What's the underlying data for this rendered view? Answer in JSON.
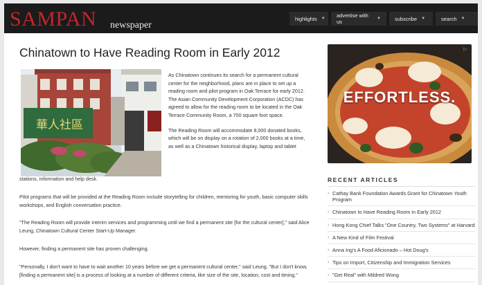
{
  "header": {
    "logo": "SAMPAN",
    "logo_sub": "newspaper",
    "nav": [
      {
        "label": "highlights"
      },
      {
        "label": "advertise with us"
      },
      {
        "label": "subscribe"
      },
      {
        "label": "search"
      }
    ]
  },
  "article": {
    "title": "Chinatown to Have Reading Room in Early 2012",
    "photo_sign": "華人社區",
    "paragraphs": [
      "As Chinatown continues its search for a permanent cultural center for the neighborhood, plans are in place to set up a reading room and pilot program in Oak Terrace for early 2012. The Asian Community Development Corporation (ACDC) has agreed to allow for the reading room to be located in the Oak Terrace Community Room, a 700 square foot space.",
      "The Reading Room will accommodate 8,000 donated books, which will be on display on a rotation of 2,000 books at a time, as well as a Chinatown historical display, laptop and tablet",
      "stations, information and help desk.",
      "Pilot programs that will be provided at the Reading Room include storytelling for children, mentoring for youth, basic computer skills workshops, and English conversation practice.",
      "\"The Reading Room will provide interim services and programming until we find a permanent site [for the cultural center],\" said Alice Leung, Chinatown Cultural Center Start-Up Manager.",
      "However, finding a permanent site has proven challenging.",
      "\"Personally, I don't want to have to wait another 10 years before we get a permanent cultural center,\" said Leung. \"But I don't know, [finding a permanent site] is a process of looking at a number of different criteria, like size of the site, location, cost and timing.\""
    ]
  },
  "sidebar": {
    "ad_text": "EFFORTLESS.",
    "ad_mark": "▷",
    "recent_title": "RECENT ARTICLES",
    "recent": [
      "Cathay Bank Foundation Awards Grant for Chinatown Youth Program",
      "Chinatown to Have Reading Room in Early 2012",
      "Hong Kong Chief Talks \"One Country, Two Systems\" at Harvard",
      "A New Kind of Film Festival",
      "Anna Ing's A Food Aficionado – Hot Doug's",
      "Tips on Import, Citizenship and Immigration Services",
      "\"Get Real\" with Mildred Wong"
    ]
  },
  "colors": {
    "logo": "#c1272d",
    "header_bg": "#1b1b1b",
    "nav_bg": "#2b2b2b"
  }
}
